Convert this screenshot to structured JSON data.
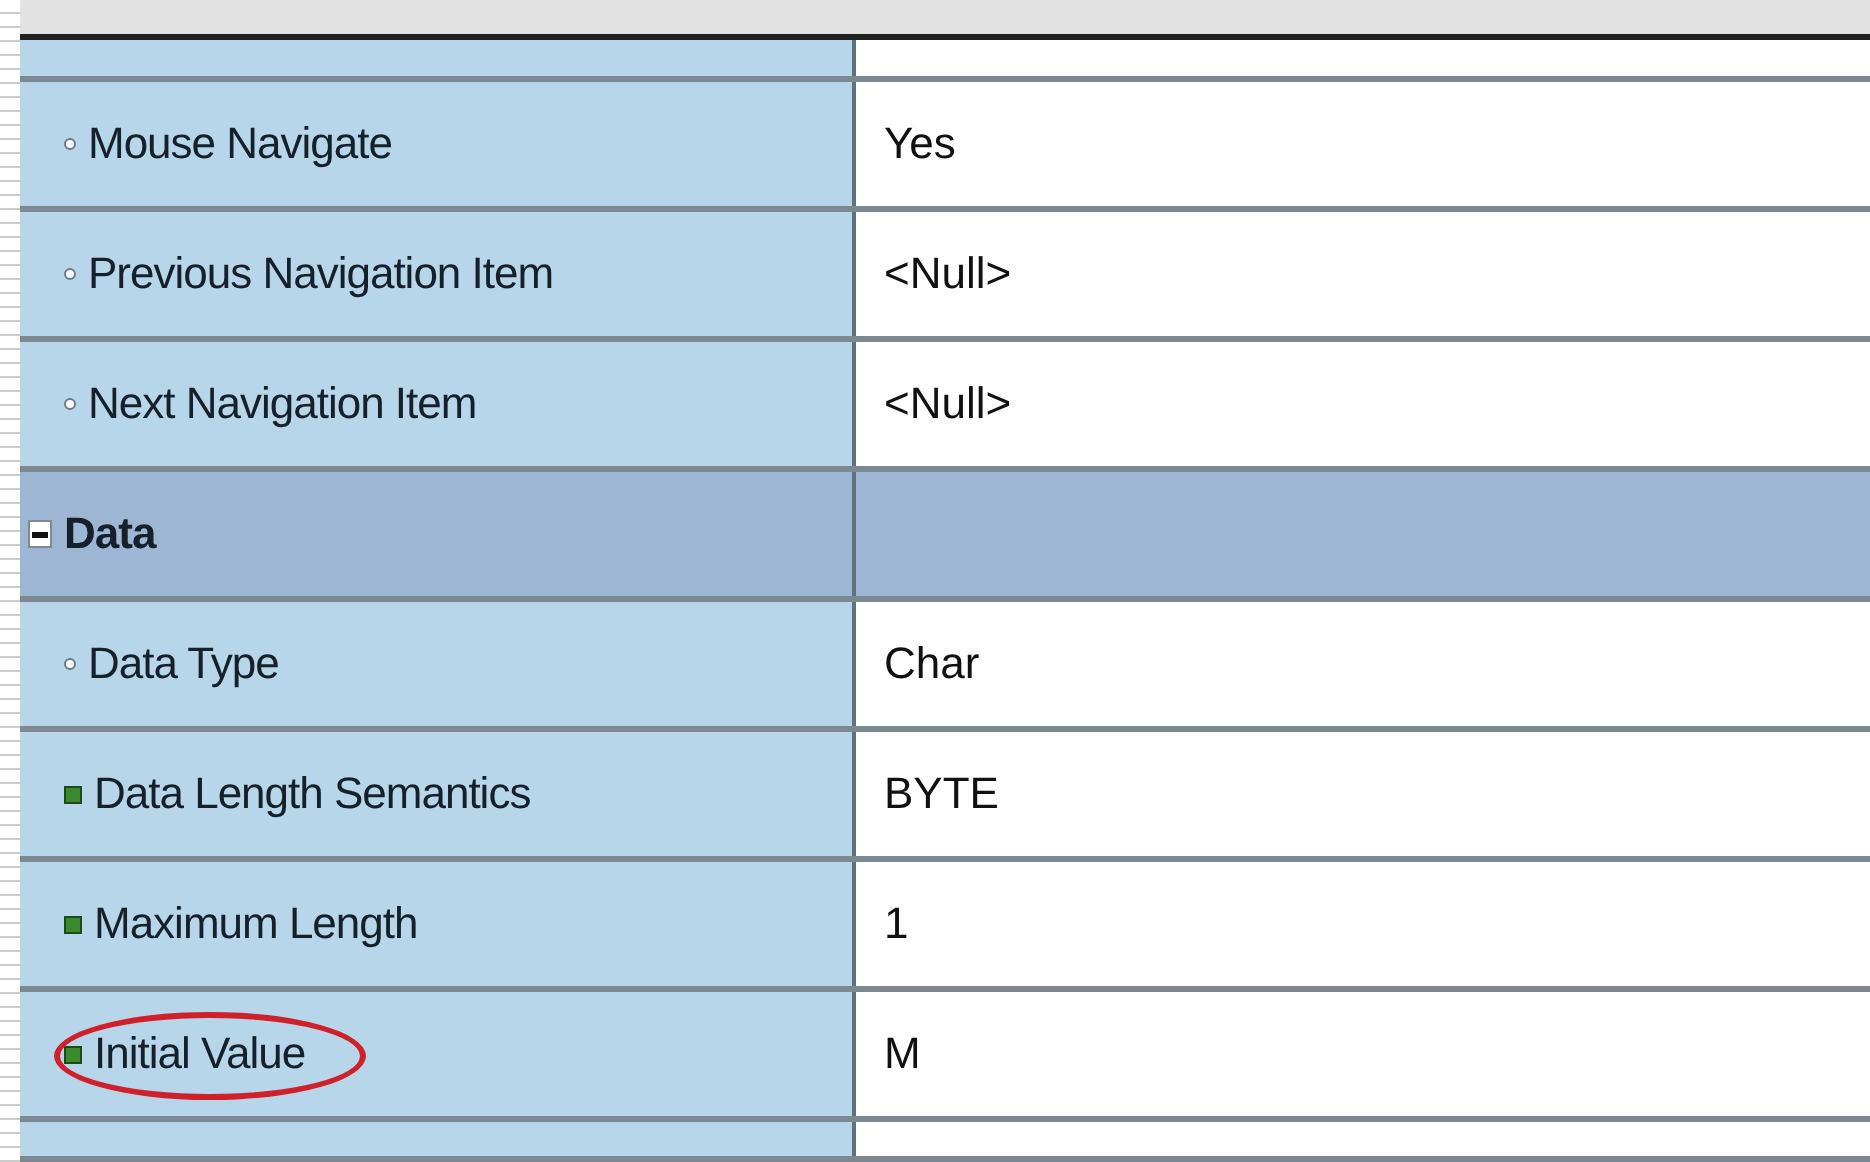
{
  "rows": [
    {
      "kind": "property",
      "modified": false,
      "label": "Mouse Navigate",
      "value": "Yes",
      "highlighted": false
    },
    {
      "kind": "property",
      "modified": false,
      "label": "Previous Navigation Item",
      "value": "<Null>",
      "highlighted": false
    },
    {
      "kind": "property",
      "modified": false,
      "label": "Next Navigation Item",
      "value": "<Null>",
      "highlighted": false
    },
    {
      "kind": "category",
      "label": "Data",
      "expanded": true
    },
    {
      "kind": "property",
      "modified": false,
      "label": "Data Type",
      "value": "Char",
      "highlighted": false
    },
    {
      "kind": "property",
      "modified": true,
      "label": "Data Length Semantics",
      "value": "BYTE",
      "highlighted": false
    },
    {
      "kind": "property",
      "modified": true,
      "label": "Maximum Length",
      "value": "1",
      "highlighted": false
    },
    {
      "kind": "property",
      "modified": true,
      "label": "Initial Value",
      "value": "M",
      "highlighted": true
    }
  ]
}
